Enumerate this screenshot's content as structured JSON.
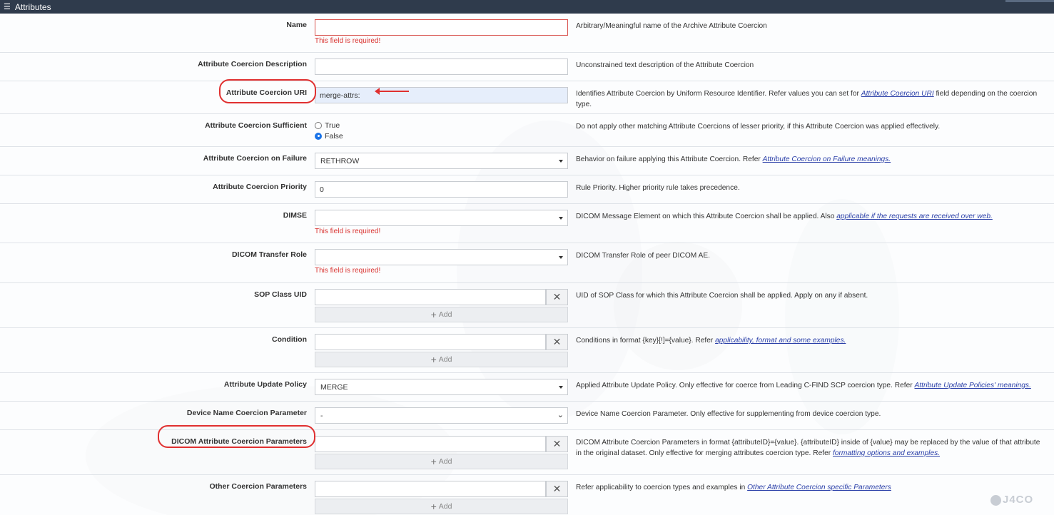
{
  "titlebar": {
    "menu_icon": "hamburger-icon",
    "title": "Attributes"
  },
  "fields": {
    "name": {
      "label": "Name",
      "value": "",
      "error": "This field is required!",
      "desc": "Arbitrary/Meaningful name of the Archive Attribute Coercion"
    },
    "description": {
      "label": "Attribute Coercion Description",
      "value": "",
      "desc": "Unconstrained text description of the Attribute Coercion"
    },
    "uri": {
      "label": "Attribute Coercion URI",
      "value": "merge-attrs:",
      "desc_pre": "Identifies Attribute Coercion by Uniform Resource Identifier. Refer values you can set for ",
      "desc_link": "Attribute Coercion URI",
      "desc_post": " field depending on the coercion type."
    },
    "sufficient": {
      "label": "Attribute Coercion Sufficient",
      "option_true": "True",
      "option_false": "False",
      "selected": "False",
      "desc": "Do not apply other matching Attribute Coercions of lesser priority, if this Attribute Coercion was applied effectively."
    },
    "on_failure": {
      "label": "Attribute Coercion on Failure",
      "value": "RETHROW",
      "desc_pre": "Behavior on failure applying this Attribute Coercion. Refer ",
      "desc_link": "Attribute Coercion on Failure meanings."
    },
    "priority": {
      "label": "Attribute Coercion Priority",
      "value": "0",
      "desc": "Rule Priority. Higher priority rule takes precedence."
    },
    "dimse": {
      "label": "DIMSE",
      "value": "",
      "error": "This field is required!",
      "desc_pre": "DICOM Message Element on which this Attribute Coercion shall be applied. Also ",
      "desc_link": "applicable if the requests are received over web."
    },
    "transfer_role": {
      "label": "DICOM Transfer Role",
      "value": "",
      "error": "This field is required!",
      "desc": "DICOM Transfer Role of peer DICOM AE."
    },
    "sop_class": {
      "label": "SOP Class UID",
      "value": "",
      "add_label": "Add",
      "desc": "UID of SOP Class for which this Attribute Coercion shall be applied. Apply on any if absent."
    },
    "condition": {
      "label": "Condition",
      "value": "",
      "add_label": "Add",
      "desc_pre": "Conditions in format {key}[!]={value}. Refer ",
      "desc_link": "applicability, format and some examples."
    },
    "update_policy": {
      "label": "Attribute Update Policy",
      "value": "MERGE",
      "desc_pre": "Applied Attribute Update Policy. Only effective for coerce from Leading C-FIND SCP coercion type. Refer ",
      "desc_link": "Attribute Update Policies' meanings."
    },
    "device_name": {
      "label": "Device Name Coercion Parameter",
      "value": "-",
      "desc": "Device Name Coercion Parameter. Only effective for supplementing from device coercion type."
    },
    "dicom_params": {
      "label": "DICOM Attribute Coercion Parameters",
      "value": "",
      "add_label": "Add",
      "desc_pre": "DICOM Attribute Coercion Parameters in format {attributeID}={value}. {attributeID} inside of {value} may be replaced by the value of that attribute in the original dataset. Only effective for merging attributes coercion type. Refer ",
      "desc_link": "formatting options and examples."
    },
    "other_params": {
      "label": "Other Coercion Parameters",
      "value": "",
      "add_label": "Add",
      "desc_pre": "Refer applicability to coercion types and examples in ",
      "desc_link": "Other Attribute Coercion specific Parameters"
    }
  },
  "logo_text": "J4CO",
  "colors": {
    "error": "#d9322f",
    "annotation": "#e03030",
    "titlebar": "#2f3b4c",
    "link": "#2a3fa8"
  }
}
